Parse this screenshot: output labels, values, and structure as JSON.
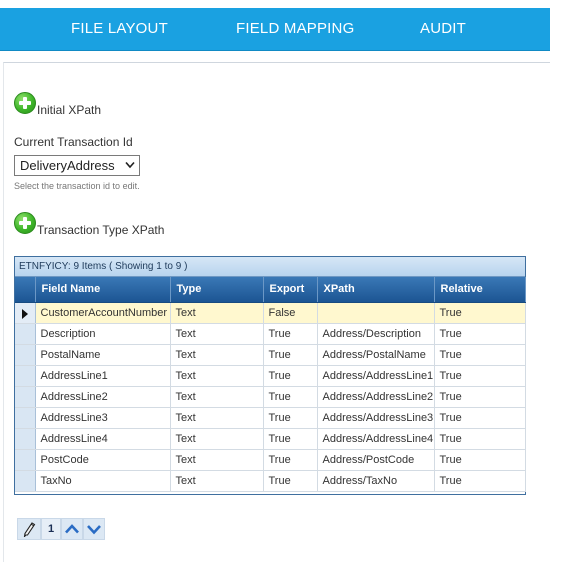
{
  "nav": {
    "tabs": [
      {
        "label": "FILE LAYOUT"
      },
      {
        "label": "FIELD MAPPING"
      },
      {
        "label": "AUDIT"
      }
    ],
    "background": "#1aa1e1"
  },
  "initial_xpath": {
    "label": "Initial XPath",
    "icon": "add-icon"
  },
  "transaction": {
    "label": "Current Transaction Id",
    "selected": "DeliveryAddress",
    "hint": "Select the transaction id to edit."
  },
  "transaction_type_xpath": {
    "label": "Transaction Type XPath",
    "icon": "add-icon"
  },
  "grid": {
    "caption": "ETNFYICY: 9 Items ( Showing 1 to 9 )",
    "columns": [
      "Field Name",
      "Type",
      "Export",
      "XPath",
      "Relative"
    ],
    "rows": [
      [
        "CustomerAccountNumber",
        "Text",
        "False",
        "",
        "True"
      ],
      [
        "Description",
        "Text",
        "True",
        "Address/Description",
        "True"
      ],
      [
        "PostalName",
        "Text",
        "True",
        "Address/PostalName",
        "True"
      ],
      [
        "AddressLine1",
        "Text",
        "True",
        "Address/AddressLine1",
        "True"
      ],
      [
        "AddressLine2",
        "Text",
        "True",
        "Address/AddressLine2",
        "True"
      ],
      [
        "AddressLine3",
        "Text",
        "True",
        "Address/AddressLine3",
        "True"
      ],
      [
        "AddressLine4",
        "Text",
        "True",
        "Address/AddressLine4",
        "True"
      ],
      [
        "PostCode",
        "Text",
        "True",
        "Address/PostCode",
        "True"
      ],
      [
        "TaxNo",
        "Text",
        "True",
        "Address/TaxNo",
        "True"
      ]
    ],
    "active_row": 0,
    "header_color": "#1c5593",
    "active_row_color": "#fff8cf"
  },
  "pager": {
    "page": "1",
    "edit_icon": "pencil-icon",
    "up_icon": "chevron-up-icon",
    "down_icon": "chevron-down-icon"
  }
}
